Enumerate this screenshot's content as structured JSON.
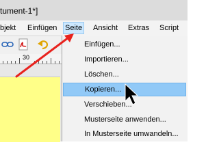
{
  "window": {
    "title": "tument-1*]"
  },
  "menubar": {
    "items": [
      {
        "label": "bjekt",
        "name": "menu-objekt",
        "active": false
      },
      {
        "label": "Einfügen",
        "name": "menu-einfuegen",
        "active": false
      },
      {
        "label": "Seite",
        "name": "menu-seite",
        "active": true
      },
      {
        "label": "Ansicht",
        "name": "menu-ansicht",
        "active": false
      },
      {
        "label": "Extras",
        "name": "menu-extras",
        "active": false
      },
      {
        "label": "Script",
        "name": "menu-script",
        "active": false
      }
    ]
  },
  "toolbar": {
    "icons": [
      "link-icon",
      "pdf-icon",
      "undo-icon"
    ]
  },
  "ruler": {
    "label_30": "30"
  },
  "page_menu": {
    "items": [
      {
        "label": "Einfügen...",
        "name": "menu-item-einfuegen"
      },
      {
        "label": "Importieren...",
        "name": "menu-item-importieren"
      },
      {
        "label": "Löschen...",
        "name": "menu-item-loeschen"
      },
      {
        "label": "Kopieren...",
        "name": "menu-item-kopieren",
        "highlighted": true
      },
      {
        "label": "Verschieben...",
        "name": "menu-item-verschieben"
      },
      {
        "label": "Musterseite anwenden...",
        "name": "menu-item-musterseite-anwenden"
      },
      {
        "label": "In Musterseite umwandeln...",
        "name": "menu-item-musterseite-umwandeln"
      }
    ]
  },
  "colors": {
    "highlight": "#91c9f7",
    "menu_active": "#cce8ff",
    "arrow": "#e8221e",
    "canvas_yellow": "#ffff88"
  }
}
